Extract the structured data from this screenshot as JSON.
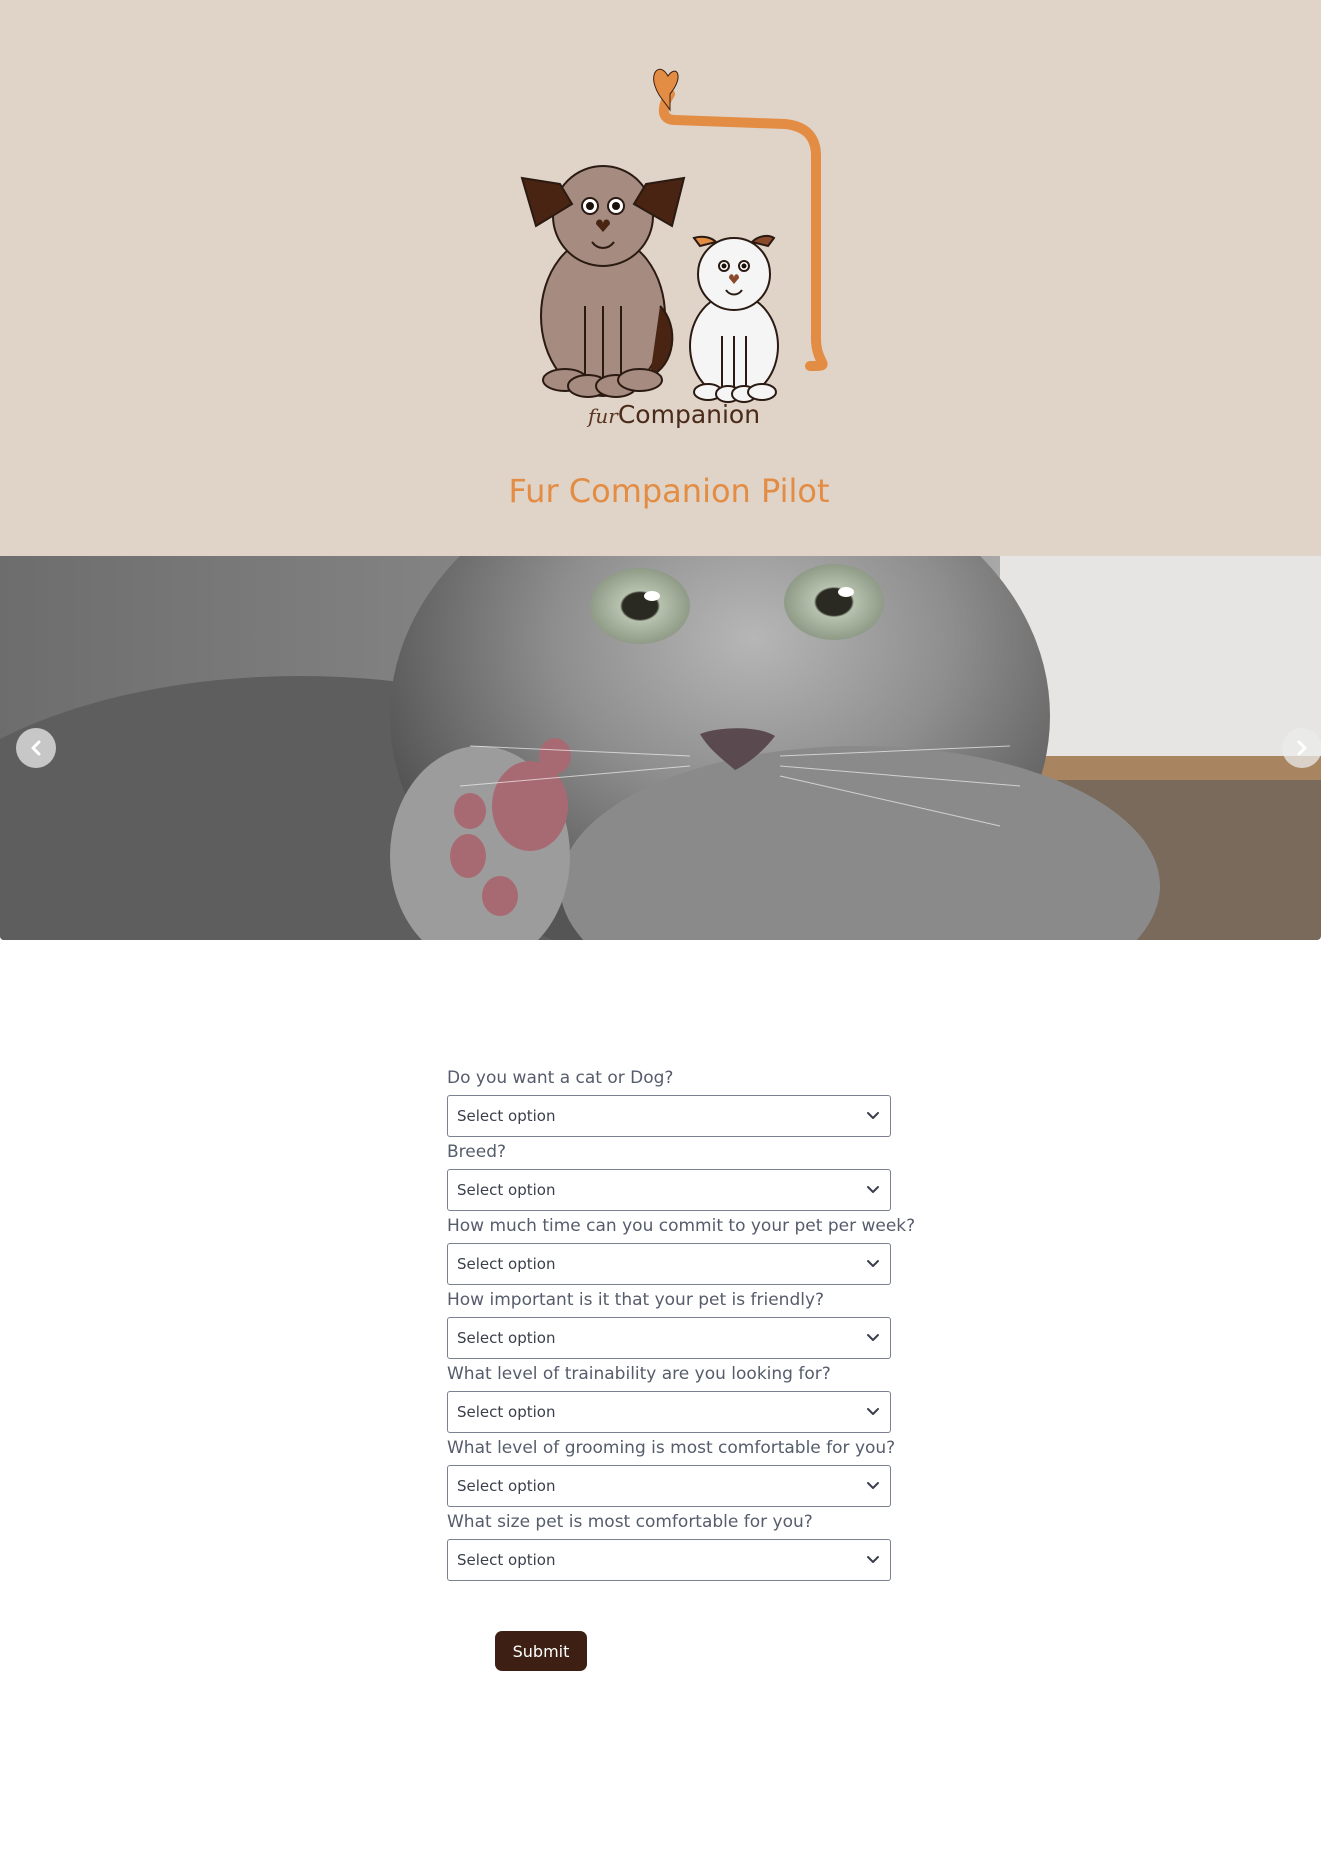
{
  "brand": {
    "logo_prefix": "fur",
    "logo_name": "Companion",
    "title": "Fur Companion Pilot"
  },
  "colors": {
    "header_bg": "#e0d3c8",
    "title_accent": "#e38c43",
    "submit_bg": "#3d2013"
  },
  "carousel": {
    "prev_icon": "chevron-left-icon",
    "next_icon": "chevron-right-icon"
  },
  "form": {
    "questions": [
      {
        "label": "Do you want a cat or Dog?",
        "value": "Select option"
      },
      {
        "label": "Breed?",
        "value": "Select option"
      },
      {
        "label": "How much time can you commit to your pet per week?",
        "value": "Select option"
      },
      {
        "label": "How important is it that your pet is friendly?",
        "value": "Select option"
      },
      {
        "label": "What level of trainability are you looking for?",
        "value": "Select option"
      },
      {
        "label": "What level of grooming is most comfortable for you?",
        "value": "Select option"
      },
      {
        "label": "What size pet is most comfortable for you?",
        "value": "Select option"
      }
    ],
    "submit_label": "Submit"
  }
}
